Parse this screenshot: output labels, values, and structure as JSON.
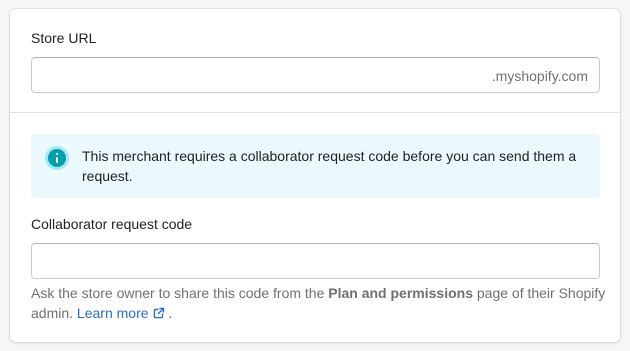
{
  "store_url": {
    "label": "Store URL",
    "value": "",
    "suffix": ".myshopify.com"
  },
  "banner": {
    "icon": "info-icon",
    "message": "This merchant requires a collaborator request code before you can send them a request."
  },
  "collaborator_code": {
    "label": "Collaborator request code",
    "value": ""
  },
  "help": {
    "text_before": "Ask the store owner to share this code from the ",
    "emphasis": "Plan and permissions",
    "text_middle": " page of their Shopify admin. ",
    "link_label": "Learn more",
    "link_icon": "external-link-icon",
    "text_after": " ."
  },
  "colors": {
    "banner_bg": "#ebf9fc",
    "info_icon": "#00a0ac",
    "link": "#2c6ecb"
  }
}
